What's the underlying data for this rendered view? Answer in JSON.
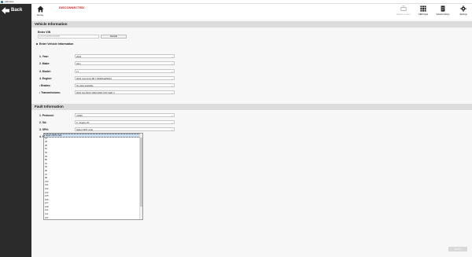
{
  "window": {
    "title": "eMonitor"
  },
  "sidebar": {
    "back_label": "Back"
  },
  "toolbar": {
    "home_label": "Home",
    "status": "DISCONNECTED",
    "status_color": "#d31f1f",
    "buttons": [
      {
        "label": "Repair Content",
        "icon": "repair-content-icon",
        "enabled": false
      },
      {
        "label": "OEM Apps",
        "icon": "grid-apps-icon",
        "enabled": true
      },
      {
        "label": "Vehicle History",
        "icon": "document-icon",
        "enabled": true
      },
      {
        "label": "Settings",
        "icon": "gear-icon",
        "enabled": true
      }
    ]
  },
  "vehicle_info": {
    "header": "Vehicle Information",
    "vin_label": "Enter VIN",
    "vin_value": "1XKYD49X5FJ123456",
    "vin_button": "Decode",
    "enter_info_label": "Enter Vehicle Information",
    "fields": [
      {
        "label": "1. Year:",
        "value": "2024"
      },
      {
        "label": "2. Make:",
        "value": "Hino"
      },
      {
        "label": "3. Model:",
        "value": "L7"
      },
      {
        "label": "4. Engine:",
        "value": "2024 Cummins 6B 7.0D000-EPDOA"
      },
      {
        "label": "• Brakes:",
        "value": "No data available"
      },
      {
        "label": "• Transmissions:",
        "value": "2024 ALLISON 1000-2000 GTR GEN 4"
      }
    ]
  },
  "fault_info": {
    "header": "Fault Information",
    "fields": [
      {
        "label": "1. Protocol:",
        "value": "J1939"
      },
      {
        "label": "2. SA:",
        "value": "0 - Engine #1"
      },
      {
        "label": "3. SPN:",
        "value": "Select SPN code"
      },
      {
        "label": "4. FMI:",
        "value": ""
      }
    ],
    "spn_options": [
      "Select SPN code",
      "27",
      "28",
      "38",
      "51",
      "52",
      "84",
      "86",
      "91",
      "94",
      "96",
      "97",
      "98",
      "100",
      "101",
      "102",
      "103",
      "105",
      "106",
      "107",
      "108",
      "110",
      "111",
      "157",
      "167",
      "168",
      "171",
      "172",
      "173",
      "174",
      "175"
    ]
  },
  "footer": {
    "button_label": "Submit"
  }
}
